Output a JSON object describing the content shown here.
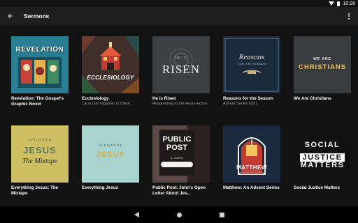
{
  "status_bar": {
    "time": "10:26"
  },
  "app_bar": {
    "title": "Sermons"
  },
  "icons": {
    "back": "arrow-back-icon",
    "more": "more-vert-icon"
  },
  "sermons": [
    {
      "title": "Revelation: The Gospel's Graphic Novel",
      "subtitle": "",
      "art": {
        "text": "REVELATION",
        "bg": "#1f6f86"
      }
    },
    {
      "title": "Ecclesiology",
      "subtitle": "Local Life Together in Christ",
      "art": {
        "text": "ECCLESIOLOGY",
        "bg": "#3a2c28"
      }
    },
    {
      "title": "He is Risen",
      "subtitle": "Responding to the Resurrection",
      "art": {
        "small": "HE IS",
        "text": "RISEN",
        "bg": "#3b4145"
      }
    },
    {
      "title": "Reasons for the Season",
      "subtitle": "Advent Series 2021",
      "art": {
        "text": "Reasons",
        "small": "FOR THE SEASON",
        "bg": "#1c2b3c"
      }
    },
    {
      "title": "We Are Christians",
      "subtitle": "",
      "art": {
        "small": "WE ARE",
        "text": "CHRISTIANS",
        "bg": "#3a3d3f"
      }
    },
    {
      "title": "Everything Jesus: The Mixtape",
      "subtitle": "",
      "art": {
        "small": "everything",
        "text": "JESUS",
        "script": "The Mixtape",
        "bg": "#cdbf62"
      }
    },
    {
      "title": "Everything Jesus",
      "subtitle": "",
      "art": {
        "small": "everything",
        "text": "JESUS",
        "bg": "#a9d3cf"
      }
    },
    {
      "title": "Public Post: John's Open Letter About Jes...",
      "subtitle": "",
      "art": {
        "text": "PUBLIC POST",
        "small": "1 JOHN",
        "bg": "#5b4a48"
      }
    },
    {
      "title": "Matthew: An Advent Series",
      "subtitle": "",
      "art": {
        "text": "MATTHEW",
        "small": "AN ADVENT SERIES",
        "bg": "#1b2a3f"
      }
    },
    {
      "title": "Social Justice Matters",
      "subtitle": "",
      "art": {
        "text1": "SOCIAL",
        "text2": "JUSTICE",
        "text3": "MATTERS",
        "bg": "#111111"
      }
    }
  ],
  "nav_bar": {
    "back": "nav-back-icon",
    "home": "nav-home-icon",
    "recents": "nav-recents-icon"
  }
}
